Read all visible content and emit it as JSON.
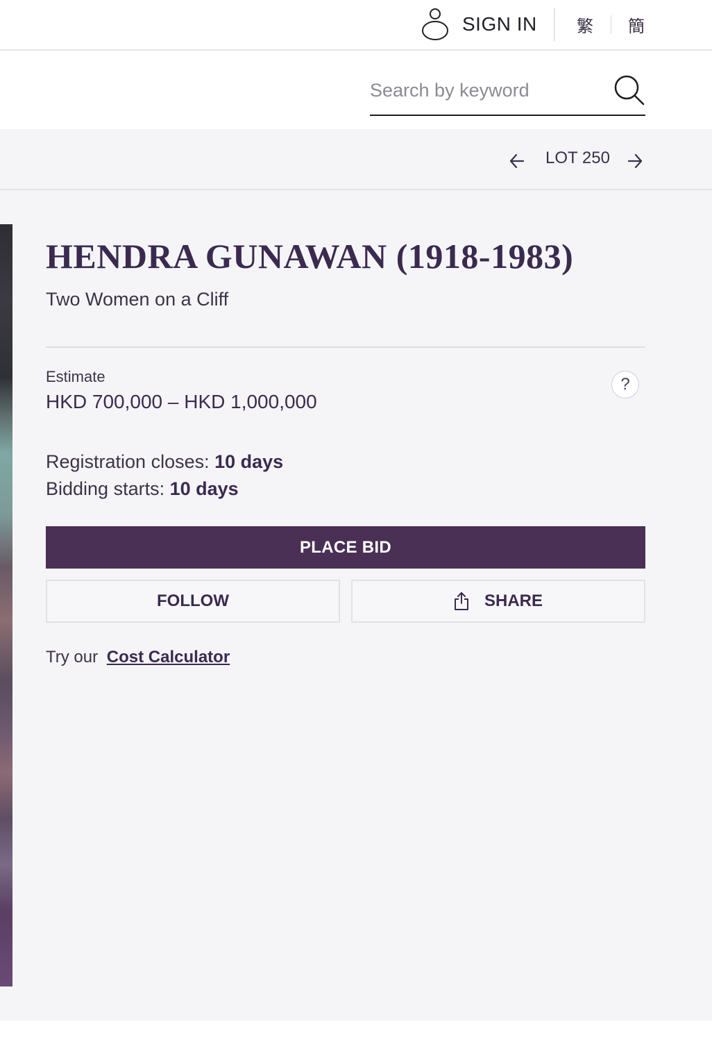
{
  "header": {
    "sign_in_label": "SIGN IN",
    "lang_traditional": "繁",
    "lang_simplified": "簡"
  },
  "search": {
    "placeholder": "Search by keyword",
    "value": ""
  },
  "lot_nav": {
    "label": "LOT 250"
  },
  "lot": {
    "title": "HENDRA GUNAWAN (1918-1983)",
    "subtitle": "Two Women on a Cliff",
    "estimate_label": "Estimate",
    "estimate_value": "HKD 700,000 – HKD 1,000,000",
    "help_symbol": "?",
    "registration_label": "Registration closes:",
    "registration_value": "10 days",
    "bidding_label": "Bidding starts:",
    "bidding_value": "10 days"
  },
  "actions": {
    "place_bid": "PLACE BID",
    "follow": "FOLLOW",
    "share": "SHARE"
  },
  "calculator": {
    "prefix": "Try our",
    "link": "Cost Calculator"
  },
  "icons": {
    "user": "user-icon",
    "search": "search-icon",
    "prev": "arrow-left-icon",
    "next": "arrow-right-icon",
    "share": "share-icon"
  },
  "colors": {
    "accent": "#4a3055",
    "text": "#3b2a4f",
    "background": "#f5f5f8"
  }
}
